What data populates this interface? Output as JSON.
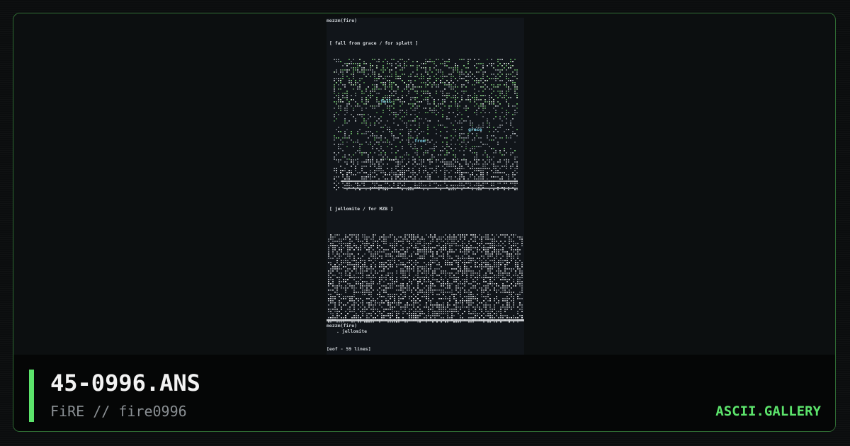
{
  "card": {
    "filename": "45-0996.ANS",
    "author_line": "FiRE // fire0996",
    "site": "ASCII.GALLERY",
    "colors": {
      "accent": "#5ce36b",
      "frame_border": "#2f6b33",
      "background": "#0b0d0e",
      "infobar": "#050606"
    }
  },
  "preview": {
    "header": "mozzm(fire)",
    "section1_header": "[ fall from grace / for splatt ]",
    "section1_words": [
      "fall",
      "from",
      "grace"
    ],
    "section2_header": "[ jellomite / for MZB ]",
    "sig_line": "mozzm(fire)",
    "sig_name": ". jellomite",
    "footer": "[eof - 59 lines]"
  }
}
